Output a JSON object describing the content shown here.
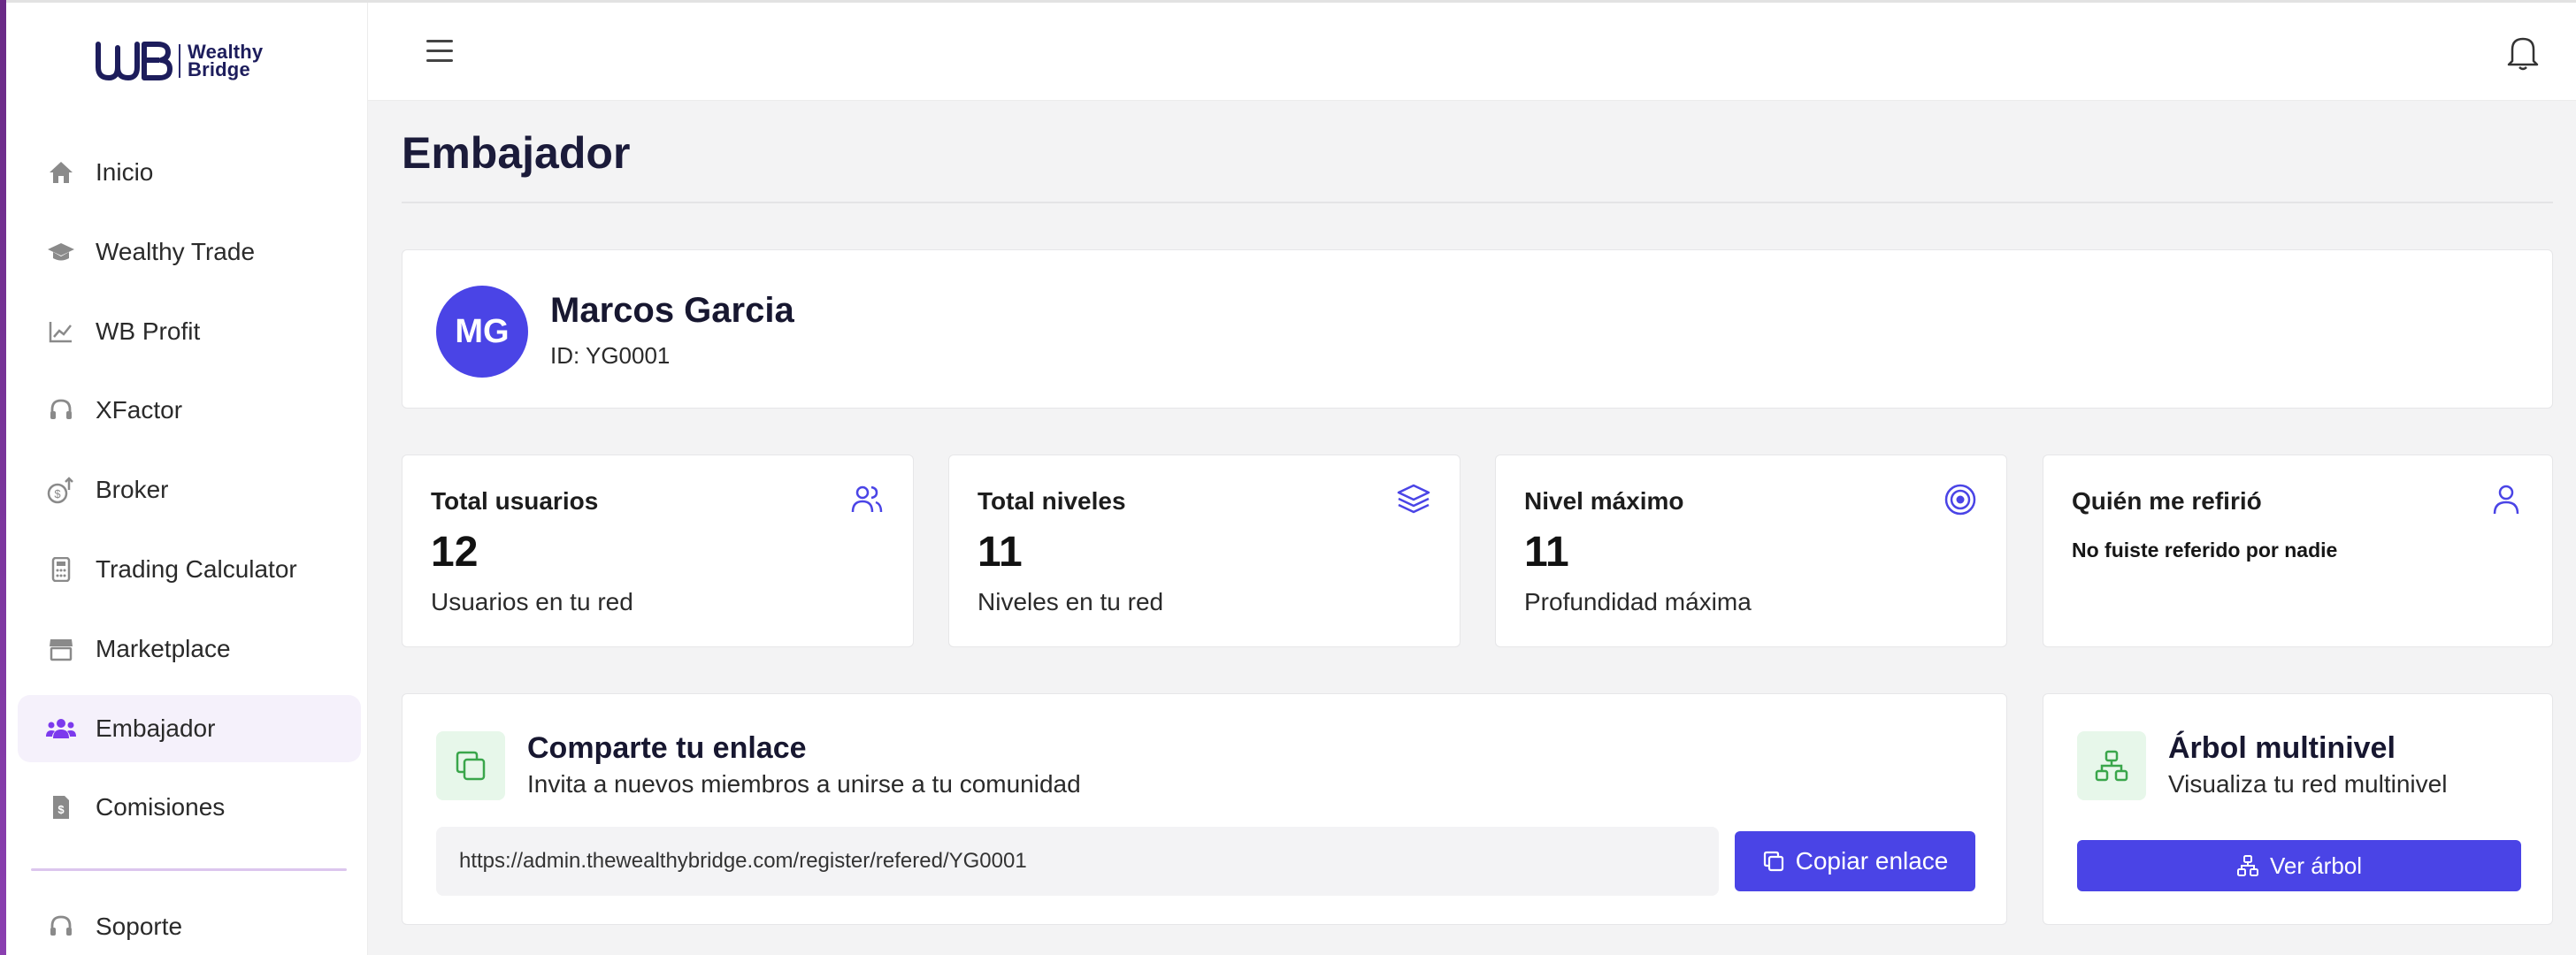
{
  "brand": {
    "logo_line1": "Wealthy",
    "logo_line2": "Bridge",
    "accent": "#4a44e6",
    "nav_icon_color": "#8a8a8a",
    "active_icon_color": "#7c3aed"
  },
  "sidebar": {
    "items": [
      {
        "label": "Inicio",
        "icon": "home-icon"
      },
      {
        "label": "Wealthy Trade",
        "icon": "graduation-cap-icon"
      },
      {
        "label": "WB Profit",
        "icon": "line-chart-icon"
      },
      {
        "label": "XFactor",
        "icon": "headset-icon"
      },
      {
        "label": "Broker",
        "icon": "coin-up-icon"
      },
      {
        "label": "Trading Calculator",
        "icon": "calculator-icon"
      },
      {
        "label": "Marketplace",
        "icon": "store-icon"
      },
      {
        "label": "Embajador",
        "icon": "users-icon",
        "active": true
      },
      {
        "label": "Comisiones",
        "icon": "invoice-icon"
      }
    ],
    "support_label": "Soporte"
  },
  "header": {
    "menu_icon": "hamburger-icon",
    "notifications_icon": "bell-icon"
  },
  "page": {
    "title": "Embajador"
  },
  "profile": {
    "initials": "MG",
    "name": "Marcos Garcia",
    "id_text": "ID: YG0001"
  },
  "stats": [
    {
      "title": "Total usuarios",
      "value": "12",
      "subtitle": "Usuarios en tu red",
      "icon": "users-outline-icon"
    },
    {
      "title": "Total niveles",
      "value": "11",
      "subtitle": "Niveles en tu red",
      "icon": "layers-icon"
    },
    {
      "title": "Nivel máximo",
      "value": "11",
      "subtitle": "Profundidad máxima",
      "icon": "target-icon"
    },
    {
      "title": "Quién me refirió",
      "note": "No fuiste referido por nadie",
      "icon": "user-outline-icon"
    }
  ],
  "share": {
    "title": "Comparte tu enlace",
    "subtitle": "Invita a nuevos miembros a unirse a tu comunidad",
    "link": "https://admin.thewealthybridge.com/register/refered/YG0001",
    "button_label": "Copiar enlace",
    "icon": "copy-icon"
  },
  "tree": {
    "title": "Árbol multinivel",
    "subtitle": "Visualiza tu red multinivel",
    "button_label": "Ver árbol",
    "icon": "sitemap-icon"
  }
}
